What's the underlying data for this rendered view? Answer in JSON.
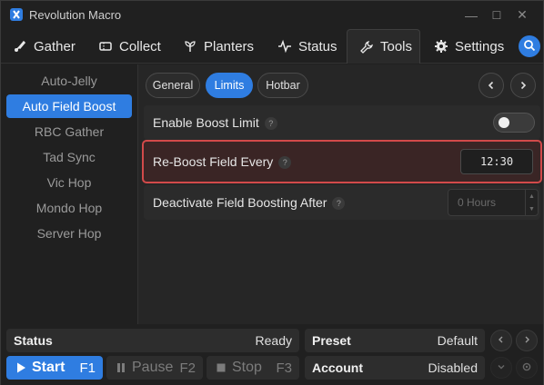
{
  "app": {
    "title": "Revolution Macro"
  },
  "window_controls": {
    "minimize": "—",
    "maximize": "☐",
    "close": "✕"
  },
  "tabs": [
    {
      "label": "Gather",
      "icon": "brush-icon"
    },
    {
      "label": "Collect",
      "icon": "ticket-icon"
    },
    {
      "label": "Planters",
      "icon": "sprout-icon"
    },
    {
      "label": "Status",
      "icon": "activity-icon"
    },
    {
      "label": "Tools",
      "icon": "wrench-icon",
      "active": true
    },
    {
      "label": "Settings",
      "icon": "gear-icon"
    }
  ],
  "sidebar": {
    "items": [
      {
        "label": "Auto-Jelly"
      },
      {
        "label": "Auto Field Boost",
        "active": true
      },
      {
        "label": "RBC Gather"
      },
      {
        "label": "Tad Sync"
      },
      {
        "label": "Vic Hop"
      },
      {
        "label": "Mondo Hop"
      },
      {
        "label": "Server Hop"
      }
    ]
  },
  "subtabs": [
    {
      "label": "General"
    },
    {
      "label": "Limits",
      "active": true
    },
    {
      "label": "Hotbar"
    }
  ],
  "settings": {
    "enable_boost_limit": {
      "label": "Enable Boost Limit",
      "help": "?",
      "enabled": false
    },
    "reboost_field_every": {
      "label": "Re-Boost Field Every",
      "help": "?",
      "value": "12:30"
    },
    "deactivate_after": {
      "label": "Deactivate Field Boosting After",
      "help": "?",
      "placeholder": "0 Hours"
    }
  },
  "bottom": {
    "status": {
      "label": "Status",
      "value": "Ready"
    },
    "preset": {
      "label": "Preset",
      "value": "Default"
    },
    "account": {
      "label": "Account",
      "value": "Disabled"
    },
    "start": {
      "label": "Start",
      "key": "F1"
    },
    "pause": {
      "label": "Pause",
      "key": "F2"
    },
    "stop": {
      "label": "Stop",
      "key": "F3"
    }
  },
  "colors": {
    "accent": "#2f7de1",
    "highlight_border": "#d24a4a"
  }
}
